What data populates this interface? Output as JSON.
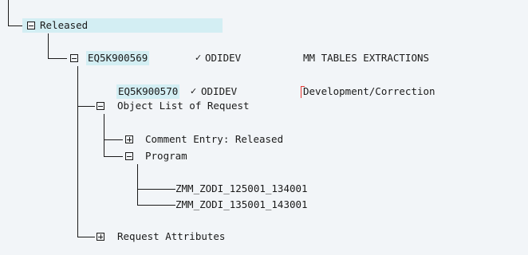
{
  "tree": {
    "released": {
      "label": "Released"
    },
    "request1": {
      "id": "EQ5K900569",
      "check": "✓",
      "owner": "ODIDEV",
      "description": "MM TABLES EXTRACTIONS"
    },
    "request2": {
      "id": "EQ5K900570",
      "check": "✓",
      "owner": "ODIDEV",
      "description": "Development/Correction"
    },
    "object_list": {
      "label": "Object List of Request"
    },
    "comment_entry": {
      "label": "Comment Entry: Released"
    },
    "program": {
      "label": "Program"
    },
    "objects": [
      "ZMM_ZODI_125001_134001",
      "ZMM_ZODI_135001_143001"
    ],
    "request_attributes": {
      "label": "Request Attributes"
    }
  },
  "colors": {
    "background": "#f2f5f8",
    "selection": "#d3eef3",
    "marker": "#e53935"
  },
  "icons": {
    "open_folder": "folder-open-icon",
    "closed_folder": "folder-closed-icon"
  }
}
